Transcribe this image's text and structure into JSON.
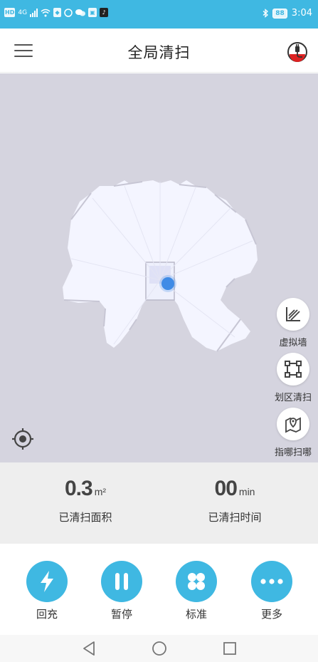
{
  "status_bar": {
    "left_badge": "HD",
    "network": "4G",
    "battery": "88",
    "time": "3:04"
  },
  "header": {
    "title": "全局清扫",
    "menu_icon": "hamburger-menu-icon",
    "right_icon": "robot-power-icon"
  },
  "map": {
    "robot_color": "#3f8be6",
    "side_tools": [
      {
        "label": "虚拟墙",
        "icon": "virtual-wall-icon"
      },
      {
        "label": "划区清扫",
        "icon": "zone-clean-icon"
      },
      {
        "label": "指哪扫哪",
        "icon": "spot-clean-icon"
      }
    ]
  },
  "stats": {
    "area_value": "0.3",
    "area_unit": "m²",
    "area_label": "已清扫面积",
    "time_value": "00",
    "time_unit": "min",
    "time_label": "已清扫时间"
  },
  "controls": [
    {
      "label": "回充",
      "icon": "lightning-icon"
    },
    {
      "label": "暂停",
      "icon": "pause-icon"
    },
    {
      "label": "标准",
      "icon": "fan-icon"
    },
    {
      "label": "更多",
      "icon": "more-dots-icon"
    }
  ],
  "colors": {
    "accent": "#3fb8e2",
    "map_background": "#d5d4df",
    "map_cleaned": "#f4f5ff"
  }
}
